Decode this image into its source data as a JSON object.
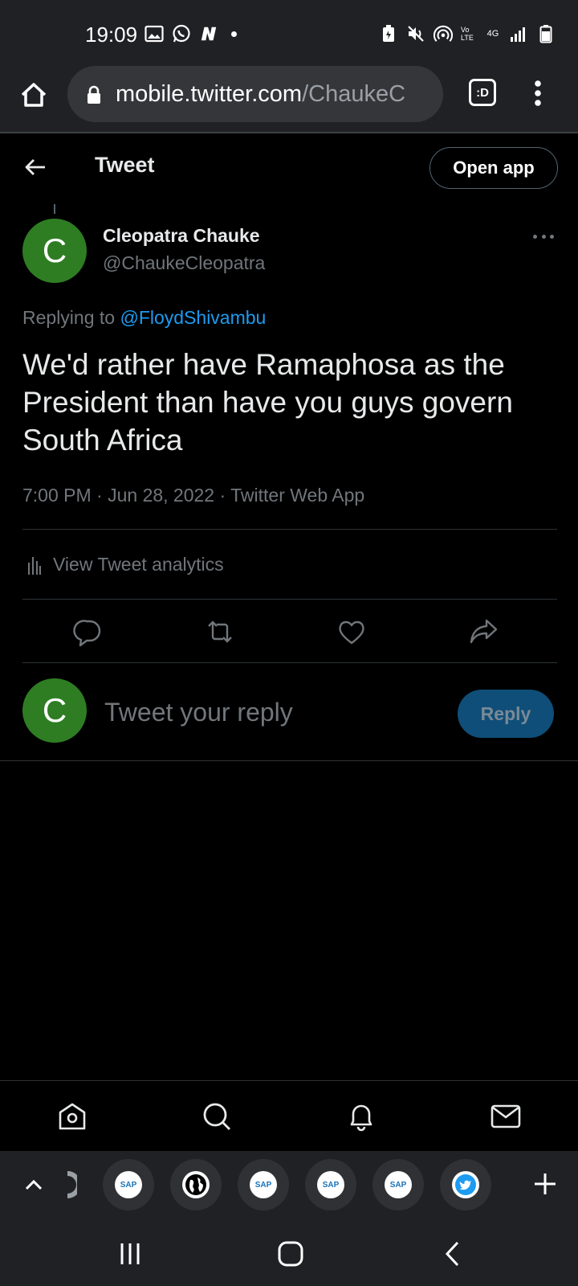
{
  "status_bar": {
    "time": "19:09",
    "left_icons": [
      "gallery-icon",
      "whatsapp-icon",
      "n-app-icon"
    ],
    "right_icons": [
      "battery-saver-icon",
      "mute-icon",
      "hotspot-icon",
      "volte-icon",
      "4g-icon",
      "signal-icon",
      "battery-icon"
    ],
    "network_label": "4G",
    "volte_label": "Vo LTE"
  },
  "browser": {
    "url_host": "mobile.twitter.com",
    "url_path": "/ChaukeC",
    "tabs_label": ":D"
  },
  "header": {
    "title": "Tweet",
    "open_app_label": "Open app"
  },
  "tweet": {
    "avatar_letter": "C",
    "author_name": "Cleopatra Chauke",
    "author_handle": "@ChaukeCleopatra",
    "replying_prefix": "Replying to ",
    "replying_to": "@FloydShivambu",
    "text": "We'd rather have Ramaphosa as the President than have you guys govern South Africa",
    "meta": "7:00 PM · Jun 28, 2022 · Twitter Web App",
    "analytics_label": "View Tweet analytics"
  },
  "reply_box": {
    "avatar_letter": "C",
    "placeholder": "Tweet your reply",
    "button_label": "Reply"
  },
  "tab_strip": {
    "favicons": [
      "sap-icon",
      "globe-icon",
      "sap-icon",
      "sap-icon",
      "sap-icon",
      "twitter-icon"
    ],
    "sap_label": "SAP"
  },
  "colors": {
    "accent": "#1d9bf0",
    "avatar": "#2e7d23",
    "reply_button": "#0f4e78"
  }
}
